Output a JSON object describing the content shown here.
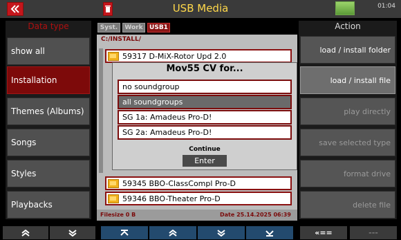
{
  "header": {
    "back_glyph": "«",
    "delete_glyph": "🗑",
    "title": "USB Media",
    "clock": "01:04",
    "disk_icon": "disk-icon"
  },
  "left": {
    "heading": "Data type",
    "items": [
      {
        "label": "show all"
      },
      {
        "label": "Installation"
      },
      {
        "label": "Themes (Albums)"
      },
      {
        "label": "Songs"
      },
      {
        "label": "Styles"
      },
      {
        "label": "Playbacks"
      }
    ]
  },
  "center": {
    "tabs": [
      "Syst.",
      "Work",
      "USB1"
    ],
    "path": "C:/INSTALL/",
    "files_top": [
      "59317 D-MiX-Rotor Upd 2.0"
    ],
    "files_bottom": [
      "59345 BBO-ClassCompl Pro-D",
      "59346 BBO-Theater Pro-D"
    ],
    "filesize": "Filesize 0 B",
    "date": "Date 25.14.2025  06:39"
  },
  "popup": {
    "title": "Mov55 CV   for...",
    "options": [
      "no soundgroup",
      "all soundgroups",
      "SG 1a:  Amadeus Pro-D!",
      "SG 2a:  Amadeus Pro-D!"
    ],
    "continue_label": "Continue",
    "enter_label": "Enter"
  },
  "right": {
    "heading": "Action",
    "items": [
      {
        "label": "load  /  install folder"
      },
      {
        "label": "load  /  install file"
      },
      {
        "label": "play directly"
      },
      {
        "label": "save selected type"
      },
      {
        "label": "format drive"
      },
      {
        "label": "delete file"
      }
    ]
  },
  "nav": {
    "b1": "≫",
    "b2": "≫",
    "b3": "⊼",
    "b4": "≫",
    "b5": "≫",
    "b6": "⊻",
    "b7": "«==",
    "b8": "---"
  },
  "colors": {
    "accent": "#c4161c",
    "title": "#ffd84a",
    "selected": "#7d0a0a"
  }
}
